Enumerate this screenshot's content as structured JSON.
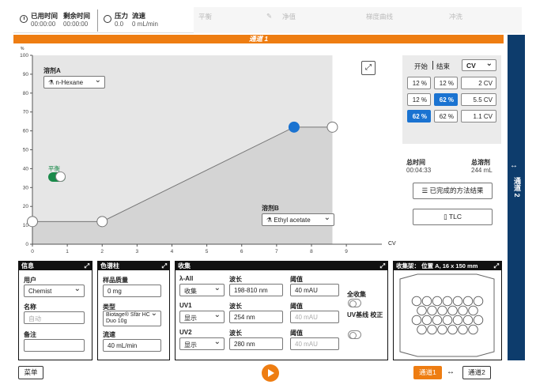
{
  "topbar": {
    "elapsed_label": "已用时间",
    "elapsed_value": "00:00:00",
    "remaining_label": "剩余时间",
    "remaining_value": "00:00:00",
    "pressure_label": "压力",
    "pressure_value": "0.0",
    "flow_label": "流速",
    "flow_value": "0 mL/min",
    "faint": [
      "平衡",
      "净值",
      "梯度曲线",
      "冲洗"
    ]
  },
  "channel_title": "通道 1",
  "side_tab": {
    "arrows": "↔",
    "label": "通道 2"
  },
  "chart_data": {
    "type": "line",
    "title": "",
    "xlabel": "CV",
    "ylabel": "%",
    "xlim": [
      0,
      9.7
    ],
    "ylim": [
      0,
      100
    ],
    "x_ticks": [
      0,
      1,
      2,
      3,
      4,
      5,
      6,
      7,
      8,
      9
    ],
    "y_ticks": [
      0,
      10,
      20,
      30,
      40,
      50,
      60,
      70,
      80,
      90,
      100
    ],
    "x": [
      0,
      2,
      7.5,
      8.6
    ],
    "values": [
      12,
      12,
      62,
      62
    ],
    "selected_point": 2,
    "shaded_end_x": 8.6,
    "grid": false
  },
  "chart_labels": {
    "solvent_a_label": "溶剂A",
    "solvent_a_value": "n-Hexane",
    "solvent_b_label": "溶剂B",
    "solvent_b_value": "Ethyl acetate",
    "equilibrate_label": "平衡"
  },
  "gradient_table": {
    "start_header": "开始",
    "end_header": "结束",
    "unit_select": "CV",
    "rows": [
      {
        "start": "12 %",
        "end": "12 %",
        "length": "2 CV",
        "start_sel": false,
        "end_sel": false
      },
      {
        "start": "12 %",
        "end": "62 %",
        "length": "5.5 CV",
        "start_sel": false,
        "end_sel": true
      },
      {
        "start": "62 %",
        "end": "62 %",
        "length": "1.1 CV",
        "start_sel": true,
        "end_sel": false
      }
    ]
  },
  "totals": {
    "time_label": "总时间",
    "time_value": "00:04:33",
    "solvent_label": "总溶剂",
    "solvent_value": "244 mL"
  },
  "buttons": {
    "completed_method": "已完成的方法结果",
    "tlc": "TLC",
    "menu": "菜单",
    "ch1": "通道1",
    "ch2": "通道2",
    "swap": "↔"
  },
  "panel_info": {
    "title": "信息",
    "user_label": "用户",
    "user_value": "Chemist",
    "name_label": "名称",
    "name_placeholder": "自动",
    "note_label": "备注"
  },
  "panel_column": {
    "title": "色谱柱",
    "sample_label": "样品质量",
    "sample_value": "0 mg",
    "type_label": "类型",
    "type_value": "Biotage® Sfär HC Duo 10g",
    "flow_label": "流速",
    "flow_value": "40 mL/min"
  },
  "panel_collect": {
    "title": "收集",
    "rows": [
      {
        "name": "λ-All",
        "mode": "收集",
        "wl_label": "波长",
        "wl": "198-810 nm",
        "th_label": "阈值",
        "th": "40 mAU",
        "th_disabled": false
      },
      {
        "name": "UV1",
        "mode": "显示",
        "wl_label": "波长",
        "wl": "254 nm",
        "th_label": "阈值",
        "th": "40 mAU",
        "th_disabled": true
      },
      {
        "name": "UV2",
        "mode": "显示",
        "wl_label": "波长",
        "wl": "280 nm",
        "th_label": "阈值",
        "th": "40 mAU",
        "th_disabled": true
      }
    ],
    "all_collect": "全收集",
    "uv_baseline": "UV基线 校正"
  },
  "panel_rack": {
    "title": "收集架：  位置 A, 16 x 150 mm"
  }
}
